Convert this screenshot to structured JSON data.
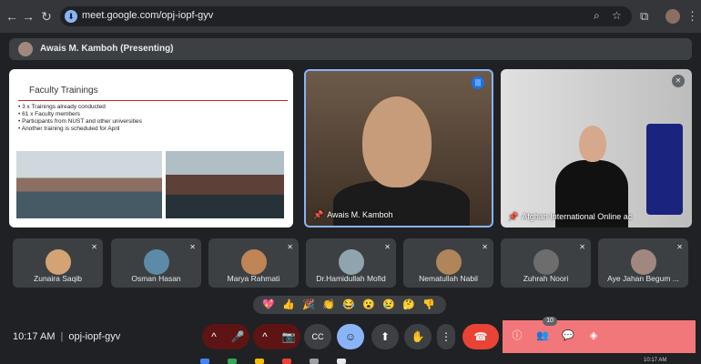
{
  "browser": {
    "url": "meet.google.com/opj-iopf-gyv",
    "icons": [
      "back-icon",
      "forward-icon",
      "reload-icon",
      "zoom-icon",
      "star-icon",
      "extension-icon",
      "profile-icon",
      "more-icon"
    ]
  },
  "presenter_bar": {
    "text": "Awais M. Kamboh (Presenting)"
  },
  "slide": {
    "title": "Faculty Trainings",
    "bullets": [
      "3 x Trainings already conducted",
      "61 x Faculty members",
      "Participants from NUST and other universities",
      "Another training is scheduled for April"
    ]
  },
  "main_tiles": [
    {
      "name": "Awais M. Kamboh",
      "status": "speaking"
    },
    {
      "name": "Afghan International Online ac",
      "status": "muted"
    }
  ],
  "participants": [
    {
      "name": "Zunaira Saqib",
      "avatar_color": "#d4a373"
    },
    {
      "name": "Osman Hasan",
      "avatar_color": "#5d8aa8"
    },
    {
      "name": "Marya Rahmati",
      "avatar_color": "#c08457"
    },
    {
      "name": "Dr.Hamidullah Mofid",
      "avatar_color": "#90a4ae"
    },
    {
      "name": "Nematullah Nabil",
      "avatar_color": "#b0855a"
    },
    {
      "name": "Zuhrah Noori",
      "avatar_color": "#6d6d6d"
    },
    {
      "name": "Aye Jahan Begum ...",
      "avatar_color": "#a1887f"
    }
  ],
  "reactions": [
    "💖",
    "👍",
    "🎉",
    "👏",
    "😂",
    "😮",
    "😢",
    "🤔",
    "👎"
  ],
  "meeting": {
    "time": "10:17 AM",
    "separator": "|",
    "code": "opj-iopf-gyv"
  },
  "controls": {
    "chevron": "^",
    "mic": "🎤",
    "camera": "📷",
    "captions": "CC",
    "reaction": "☺",
    "present": "⬆",
    "raise_hand": "✋",
    "more": "⋮",
    "hangup": "☎"
  },
  "side_panel": {
    "participant_count": "10"
  },
  "taskbar": {
    "time": "10:17 AM"
  }
}
